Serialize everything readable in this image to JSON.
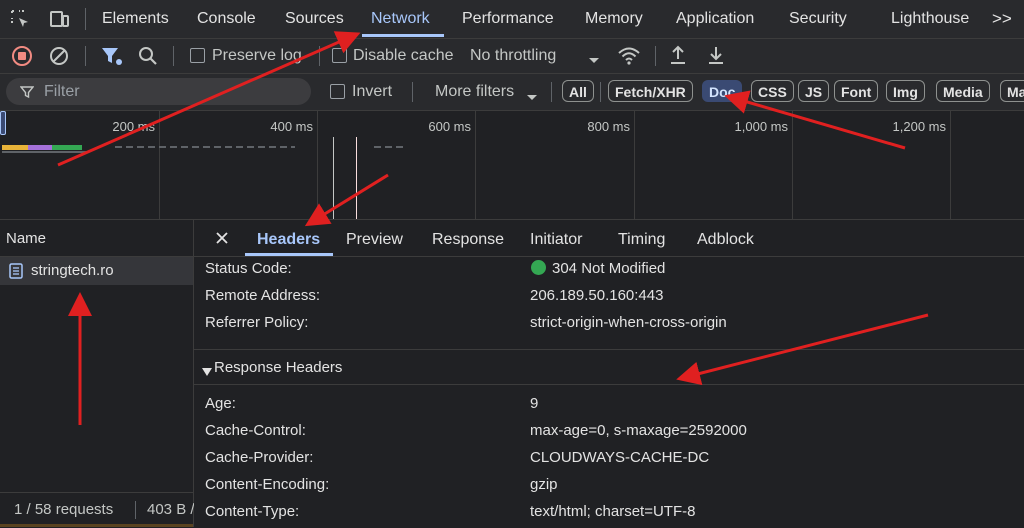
{
  "colors": {
    "accent": "#a8c7fa",
    "status_ok": "#34a853",
    "arrow": "#e02020",
    "bg": "#202124",
    "stop": "#f28b82"
  },
  "tabs": {
    "inspect_icon": "inspect-element-icon",
    "device_icon": "device-toolbar-icon",
    "items": [
      "Elements",
      "Console",
      "Sources",
      "Network",
      "Performance",
      "Memory",
      "Application",
      "Security",
      "Lighthouse"
    ],
    "active": "Network",
    "more_label": ">>"
  },
  "toolbar": {
    "preserve_log": "Preserve log",
    "disable_cache": "Disable cache",
    "throttling": "No throttling"
  },
  "filterbar": {
    "filter_placeholder": "Filter",
    "invert": "Invert",
    "more_filters": "More filters",
    "chips": [
      "All",
      "Fetch/XHR",
      "Doc",
      "CSS",
      "JS",
      "Font",
      "Img",
      "Media",
      "Ma"
    ],
    "active_chip": "Doc"
  },
  "timeline": {
    "ticks": [
      "200 ms",
      "400 ms",
      "600 ms",
      "800 ms",
      "1,000 ms",
      "1,200 ms"
    ]
  },
  "requests": {
    "header": "Name",
    "items": [
      {
        "name": "stringtech.ro"
      }
    ],
    "footer_count": "1 / 58 requests",
    "footer_size": "403 B /"
  },
  "details": {
    "tabs": [
      "Headers",
      "Preview",
      "Response",
      "Initiator",
      "Timing",
      "Adblock"
    ],
    "active_tab": "Headers",
    "general": [
      {
        "label": "Status Code:",
        "value": "304 Not Modified"
      },
      {
        "label": "Remote Address:",
        "value": "206.189.50.160:443"
      },
      {
        "label": "Referrer Policy:",
        "value": "strict-origin-when-cross-origin"
      }
    ],
    "response_headers_title": "Response Headers",
    "response_headers": [
      {
        "label": "Age:",
        "value": "9"
      },
      {
        "label": "Cache-Control:",
        "value": "max-age=0, s-maxage=2592000"
      },
      {
        "label": "Cache-Provider:",
        "value": "CLOUDWAYS-CACHE-DC"
      },
      {
        "label": "Content-Encoding:",
        "value": "gzip"
      },
      {
        "label": "Content-Type:",
        "value": "text/html; charset=UTF-8"
      }
    ]
  }
}
